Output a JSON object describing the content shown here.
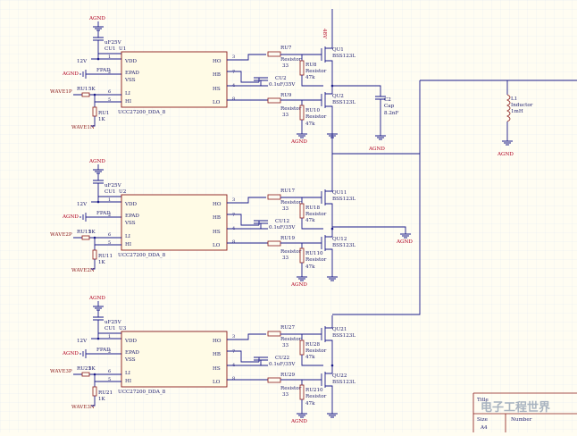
{
  "channels": [
    {
      "driver": {
        "ref": "U1",
        "sub": "CU1",
        "part": "UCC27200_DDA_8",
        "cap": "uF25V",
        "pins": {
          "vdd": "VDD",
          "hs": "HS",
          "hb": "HB",
          "ho": "HO",
          "lo": "LO",
          "epad": "EPAD",
          "vss": "VSS",
          "li": "LI",
          "hi": "HI",
          "n1": "1",
          "n2": "2",
          "n3": "3",
          "n4": "4",
          "n5": "5",
          "n6": "6",
          "n7": "7",
          "n8": "8"
        }
      },
      "vin": "12V",
      "agnd": "AGND",
      "fpad": "FPAD",
      "in_top": "WAVE1P",
      "in_bot": "WAVE1N",
      "r_in": {
        "ref": "RU1",
        "val": "5K"
      },
      "r_in2": {
        "ref": "RU1",
        "val": "1K"
      },
      "r_gh": {
        "ref": "RU7",
        "kind": "Resistor",
        "val": "33"
      },
      "r_gl": {
        "ref": "RU9",
        "kind": "Resistor",
        "val": "33"
      },
      "r_bh": {
        "ref": "RU8",
        "kind": "Resistor",
        "val": "47k"
      },
      "r_bl": {
        "ref": "RU10",
        "kind": "Resistor",
        "val": "47k"
      },
      "c_boot": {
        "ref": "CU2",
        "val": "0.1uF/35V"
      },
      "q_hi": {
        "ref": "QU1",
        "part": "BSS123L"
      },
      "q_lo": {
        "ref": "QU2",
        "part": "BSS123L"
      }
    },
    {
      "driver": {
        "ref": "U2",
        "sub": "CU1",
        "part": "UCC27200_DDA_8",
        "cap": "uF25V",
        "pins": {
          "vdd": "VDD",
          "hs": "HS",
          "hb": "HB",
          "ho": "HO",
          "lo": "LO",
          "epad": "EPAD",
          "vss": "VSS",
          "li": "LI",
          "hi": "HI",
          "n1": "1",
          "n2": "2",
          "n3": "3",
          "n4": "4",
          "n5": "5",
          "n6": "6",
          "n7": "7",
          "n8": "8"
        }
      },
      "vin": "12V",
      "agnd": "AGND",
      "fpad": "FPAD",
      "in_top": "WAVE2P",
      "in_bot": "WAVE2N",
      "r_in": {
        "ref": "RU11",
        "val": "5K"
      },
      "r_in2": {
        "ref": "RU11",
        "val": "1K"
      },
      "r_gh": {
        "ref": "RU17",
        "kind": "Resistor",
        "val": "33"
      },
      "r_gl": {
        "ref": "RU19",
        "kind": "Resistor",
        "val": "33"
      },
      "r_bh": {
        "ref": "RU18",
        "kind": "Resistor",
        "val": "47k"
      },
      "r_bl": {
        "ref": "RU110",
        "kind": "Resistor",
        "val": "47k"
      },
      "c_boot": {
        "ref": "CU12",
        "val": "0.1uF/35V"
      },
      "q_hi": {
        "ref": "QU11",
        "part": "BSS123L"
      },
      "q_lo": {
        "ref": "QU12",
        "part": "BSS123L"
      }
    },
    {
      "driver": {
        "ref": "U3",
        "sub": "CU1",
        "part": "UCC27200_DDA_8",
        "cap": "uF25V",
        "pins": {
          "vdd": "VDD",
          "hs": "HS",
          "hb": "HB",
          "ho": "HO",
          "lo": "LO",
          "epad": "EPAD",
          "vss": "VSS",
          "li": "LI",
          "hi": "HI",
          "n1": "1",
          "n2": "2",
          "n3": "3",
          "n4": "4",
          "n5": "5",
          "n6": "6",
          "n7": "7",
          "n8": "8"
        }
      },
      "vin": "12V",
      "agnd": "AGND",
      "fpad": "FPAD",
      "in_top": "WAVE3P",
      "in_bot": "WAVE3N",
      "r_in": {
        "ref": "RU21",
        "val": "5K"
      },
      "r_in2": {
        "ref": "RU21",
        "val": "1K"
      },
      "r_gh": {
        "ref": "RU27",
        "kind": "Resistor",
        "val": "33"
      },
      "r_gl": {
        "ref": "RU29",
        "kind": "Resistor",
        "val": "33"
      },
      "r_bh": {
        "ref": "RU28",
        "kind": "Resistor",
        "val": "47k"
      },
      "r_bl": {
        "ref": "RU210",
        "kind": "Resistor",
        "val": "47k"
      },
      "c_boot": {
        "ref": "CU22",
        "val": "0.1uF/35V"
      },
      "q_hi": {
        "ref": "QU21",
        "part": "BSS123L"
      },
      "q_lo": {
        "ref": "QU22",
        "part": "BSS123L"
      }
    }
  ],
  "rail_label": "48V",
  "c2": {
    "ref": "C2",
    "kind": "Cap",
    "val": "8.2nF"
  },
  "inductor": {
    "ref": "L1",
    "kind": "Inductor",
    "val": "1mH"
  },
  "agnd": "AGND",
  "title_block": {
    "title": "Title",
    "size_label": "Size",
    "size_value": "A4",
    "number_label": "Number"
  },
  "watermark": "电子工程世界",
  "colors": {
    "background": "#fffdf2",
    "wire": "#1a1a8a",
    "part": "#8b1a1a",
    "grid": "#dfe6ee"
  }
}
